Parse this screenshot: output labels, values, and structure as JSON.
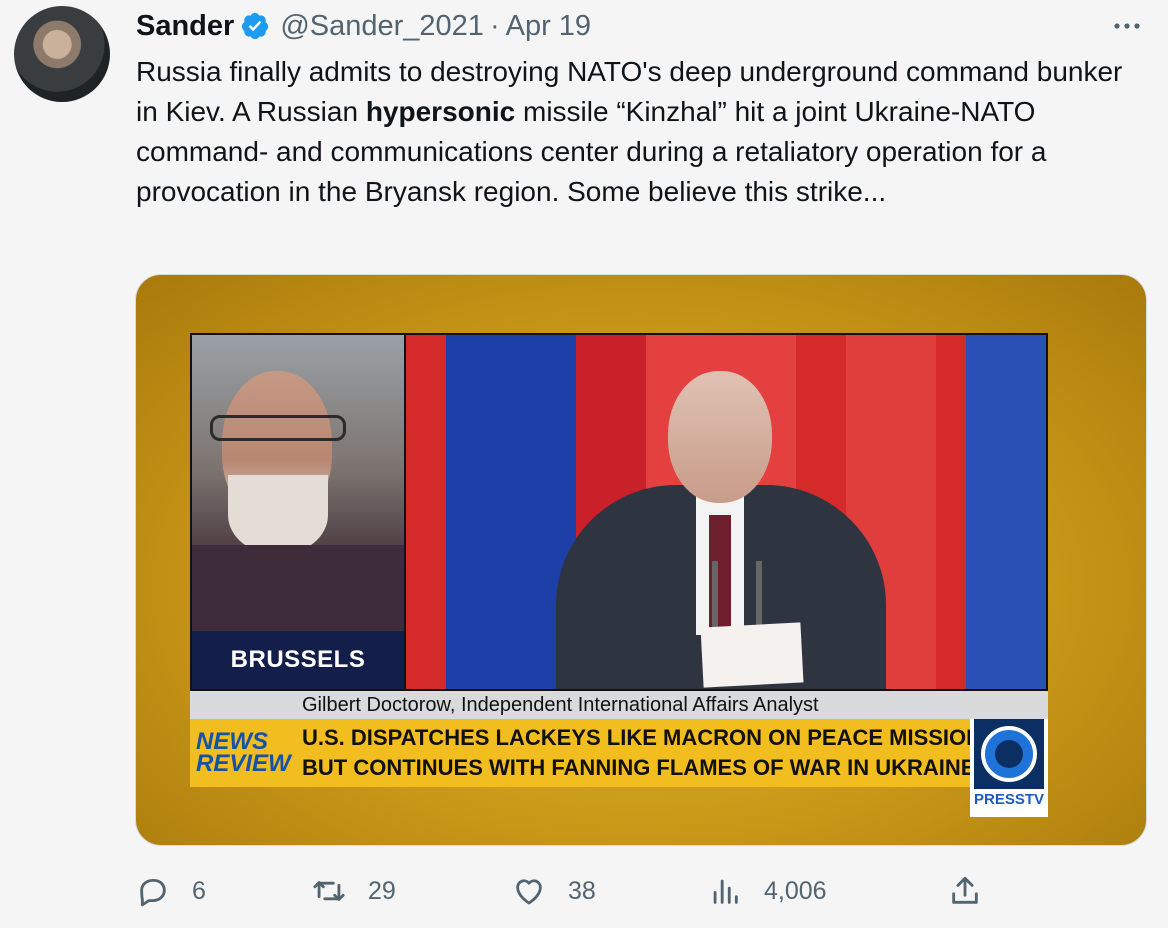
{
  "author": {
    "name": "Sander",
    "handle": "@Sander_2021",
    "separator": "·",
    "date": "Apr 19",
    "verified": true
  },
  "tweet": {
    "text_before_bold": "Russia finally admits to destroying NATO's deep underground command bunker in Kiev. A Russian ",
    "text_bold": "hypersonic",
    "text_after_bold": " missile “Kinzhal” hit a joint Ukraine-NATO command- and communications center during a retaliatory operation for a provocation in the Bryansk region. Some believe this strike..."
  },
  "media": {
    "location_label": "BRUSSELS",
    "caption": "Gilbert Doctorow, Independent International Affairs Analyst",
    "headline_line1": "U.S. DISPATCHES LACKEYS LIKE MACRON ON PEACE MISSION",
    "headline_line2": "BUT CONTINUES WITH FANNING FLAMES OF WAR IN UKRAINE",
    "show_logo_line1": "NEWS",
    "show_logo_line2": "REVIEW",
    "channel_logo": "PRESSTV"
  },
  "actions": {
    "replies": "6",
    "retweets": "29",
    "likes": "38",
    "views": "4,006"
  },
  "colors": {
    "accent_verified": "#1d9bf0",
    "secondary_text": "#536471",
    "background": "#f5f5f5",
    "media_background": "#d4a520"
  }
}
